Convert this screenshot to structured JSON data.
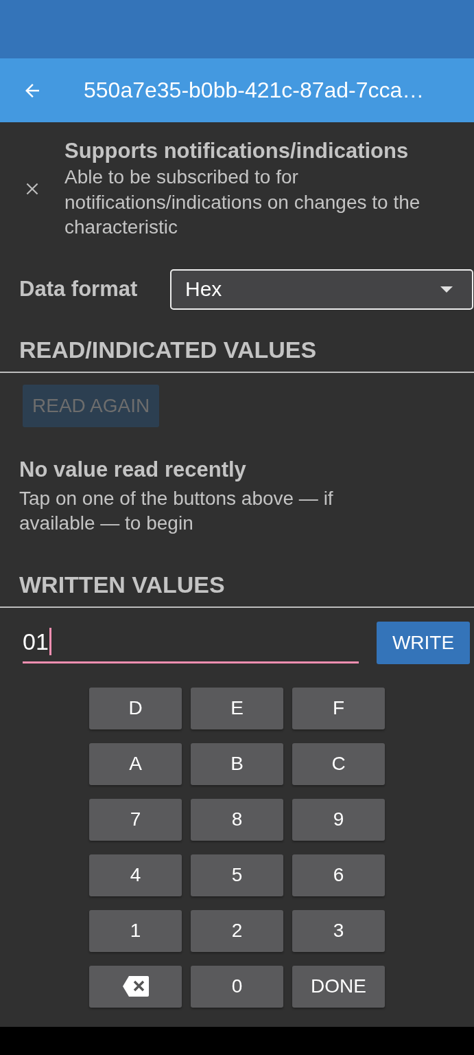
{
  "app_bar": {
    "title": "550a7e35-b0bb-421c-87ad-7cca…"
  },
  "notice": {
    "title": "Supports notifications/indications",
    "description": "Able to be subscribed to for notifications/indications on changes to the characteristic"
  },
  "data_format": {
    "label": "Data format",
    "value": "Hex"
  },
  "read_section": {
    "heading": "READ/INDICATED VALUES",
    "button": {
      "label": "READ AGAIN",
      "disabled": true
    },
    "empty_title": "No value read recently",
    "empty_text": "Tap on one of the buttons above — if available — to begin"
  },
  "write_section": {
    "heading": "WRITTEN VALUES",
    "input_value": "01",
    "button": "WRITE"
  },
  "keypad": [
    {
      "kind": "text",
      "label": "D"
    },
    {
      "kind": "text",
      "label": "E"
    },
    {
      "kind": "text",
      "label": "F"
    },
    {
      "kind": "text",
      "label": "A"
    },
    {
      "kind": "text",
      "label": "B"
    },
    {
      "kind": "text",
      "label": "C"
    },
    {
      "kind": "text",
      "label": "7"
    },
    {
      "kind": "text",
      "label": "8"
    },
    {
      "kind": "text",
      "label": "9"
    },
    {
      "kind": "text",
      "label": "4"
    },
    {
      "kind": "text",
      "label": "5"
    },
    {
      "kind": "text",
      "label": "6"
    },
    {
      "kind": "text",
      "label": "1"
    },
    {
      "kind": "text",
      "label": "2"
    },
    {
      "kind": "text",
      "label": "3"
    },
    {
      "kind": "backspace"
    },
    {
      "kind": "text",
      "label": "0"
    },
    {
      "kind": "text",
      "label": "DONE"
    }
  ]
}
